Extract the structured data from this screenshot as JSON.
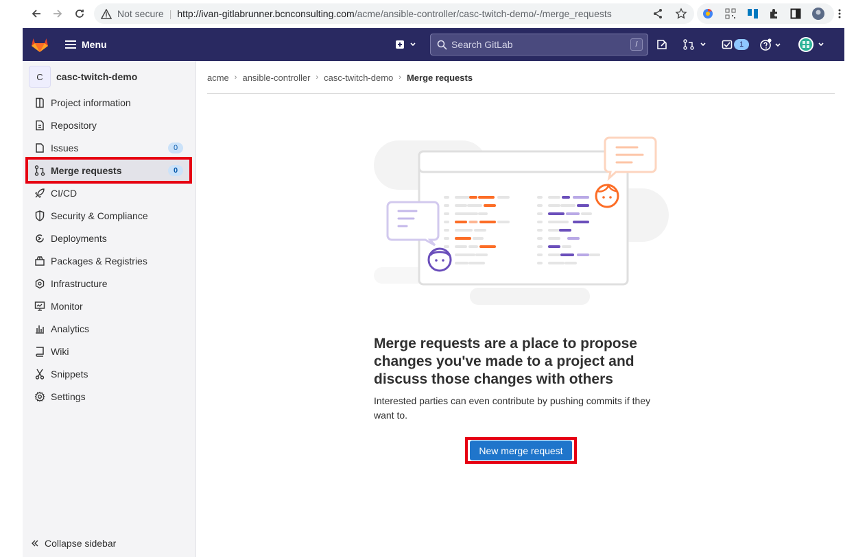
{
  "browser": {
    "security_label": "Not secure",
    "url_host": "http://ivan-gitlabrunner.bcnconsulting.com",
    "url_path": "/acme/ansible-controller/casc-twitch-demo/-/merge_requests"
  },
  "topbar": {
    "menu_label": "Menu",
    "search_placeholder": "Search GitLab",
    "search_shortcut": "/",
    "todo_count": "1"
  },
  "sidebar": {
    "project_initial": "C",
    "project_name": "casc-twitch-demo",
    "items": [
      {
        "label": "Project information",
        "icon": "project-icon"
      },
      {
        "label": "Repository",
        "icon": "doc-icon"
      },
      {
        "label": "Issues",
        "icon": "issues-icon",
        "count": "0"
      },
      {
        "label": "Merge requests",
        "icon": "merge-request-icon",
        "count": "0"
      },
      {
        "label": "CI/CD",
        "icon": "rocket-icon"
      },
      {
        "label": "Security & Compliance",
        "icon": "shield-icon"
      },
      {
        "label": "Deployments",
        "icon": "deployments-icon"
      },
      {
        "label": "Packages & Registries",
        "icon": "package-icon"
      },
      {
        "label": "Infrastructure",
        "icon": "infrastructure-icon"
      },
      {
        "label": "Monitor",
        "icon": "monitor-icon"
      },
      {
        "label": "Analytics",
        "icon": "analytics-icon"
      },
      {
        "label": "Wiki",
        "icon": "book-icon"
      },
      {
        "label": "Snippets",
        "icon": "snippet-icon"
      },
      {
        "label": "Settings",
        "icon": "gear-icon"
      }
    ],
    "collapse_label": "Collapse sidebar"
  },
  "breadcrumb": [
    "acme",
    "ansible-controller",
    "casc-twitch-demo",
    "Merge requests"
  ],
  "empty_state": {
    "title": "Merge requests are a place to propose changes you've made to a project and discuss those changes with others",
    "description": "Interested parties can even contribute by pushing commits if they want to.",
    "button_label": "New merge request"
  }
}
